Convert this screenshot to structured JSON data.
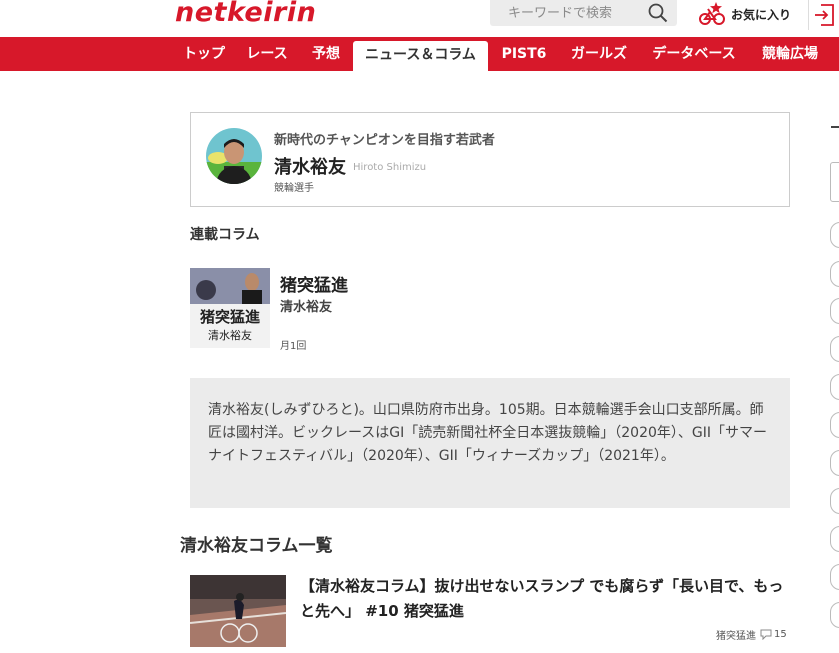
{
  "header": {
    "logo": "netkeirin",
    "search_placeholder": "キーワードで検索",
    "favorites_label": "お気に入り"
  },
  "nav": {
    "items": [
      {
        "label": "トップ",
        "active": false
      },
      {
        "label": "レース",
        "active": false
      },
      {
        "label": "予想",
        "active": false
      },
      {
        "label": "ニュース＆コラム",
        "active": true
      },
      {
        "label": "PIST6",
        "active": false
      },
      {
        "label": "ガールズ",
        "active": false
      },
      {
        "label": "データベース",
        "active": false
      },
      {
        "label": "競輪広場",
        "active": false
      }
    ]
  },
  "profile": {
    "tagline": "新時代のチャンピオンを目指す若武者",
    "name": "清水裕友",
    "name_roman": "Hiroto Shimizu",
    "role": "競輪選手"
  },
  "serial": {
    "heading": "連載コラム",
    "title": "猪突猛進",
    "author": "清水裕友",
    "frequency": "月1回",
    "thumb_text": "猪突猛進",
    "thumb_sub": "清水裕友"
  },
  "bio": {
    "text": "清水裕友(しみずひろと)。山口県防府市出身。105期。日本競輪選手会山口支部所属。師匠は國村洋。ビックレースはGI「読売新聞社杯全日本選抜競輪」（2020年）、GII「サマーナイトフェスティバル」（2020年）、GII「ウィナーズカップ」（2021年）。"
  },
  "columns": {
    "heading": "清水裕友コラム一覧",
    "articles": [
      {
        "title": "【清水裕友コラム】抜け出せないスランプ でも腐らず「長い目で、もっと先へ」 #10 猪突猛進",
        "series": "猪突猛進",
        "comments": "15"
      }
    ]
  },
  "colors": {
    "brand_red": "#d7182a",
    "bio_bg": "#ebebeb"
  },
  "icons": [
    "search-icon",
    "bicycle-star-icon",
    "login-icon",
    "comment-icon"
  ]
}
